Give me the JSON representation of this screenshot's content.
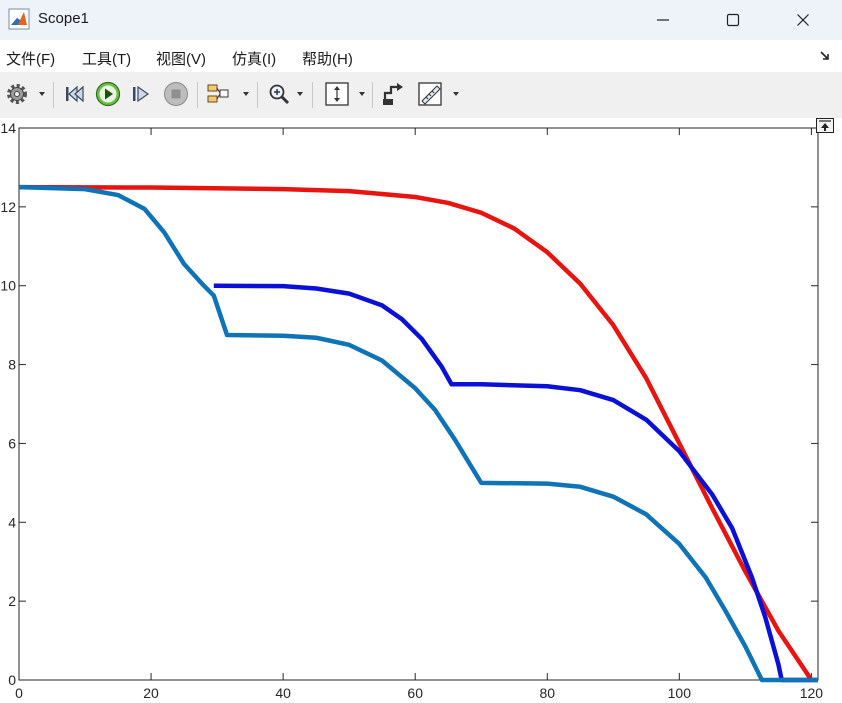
{
  "window": {
    "title": "Scope1"
  },
  "menu": {
    "items": [
      {
        "label": "文件(F)"
      },
      {
        "label": "工具(T)"
      },
      {
        "label": "视图(V)"
      },
      {
        "label": "仿真(I)"
      },
      {
        "label": "帮助(H)"
      }
    ]
  },
  "toolbar": {
    "icons": [
      "gear-icon",
      "rewind-icon",
      "run-icon",
      "step-forward-icon",
      "stop-icon",
      "signal-selector-icon",
      "zoom-in-icon",
      "fit-axes-icon",
      "highlight-block-icon",
      "measurements-icon"
    ]
  },
  "chart_data": {
    "type": "line",
    "xlim": [
      0,
      121
    ],
    "ylim": [
      0,
      14
    ],
    "xticks": [
      0,
      20,
      40,
      60,
      80,
      100,
      120
    ],
    "yticks": [
      0,
      2,
      4,
      6,
      8,
      10,
      12,
      14
    ],
    "grid": false,
    "series": [
      {
        "color": "#e8140f",
        "points": [
          [
            0,
            12.5
          ],
          [
            20,
            12.49
          ],
          [
            40,
            12.45
          ],
          [
            50,
            12.4
          ],
          [
            60,
            12.25
          ],
          [
            65,
            12.1
          ],
          [
            70,
            11.85
          ],
          [
            75,
            11.45
          ],
          [
            80,
            10.85
          ],
          [
            85,
            10.05
          ],
          [
            90,
            9.0
          ],
          [
            95,
            7.65
          ],
          [
            100,
            6.0
          ],
          [
            105,
            4.35
          ],
          [
            110,
            2.75
          ],
          [
            115,
            1.25
          ],
          [
            118,
            0.5
          ],
          [
            120,
            0.0
          ]
        ]
      },
      {
        "color": "#0a10d6",
        "points": [
          [
            29.5,
            10.0
          ],
          [
            40,
            9.99
          ],
          [
            45,
            9.93
          ],
          [
            50,
            9.8
          ],
          [
            55,
            9.5
          ],
          [
            58,
            9.15
          ],
          [
            61,
            8.65
          ],
          [
            64,
            7.95
          ],
          [
            65.5,
            7.5
          ],
          [
            70,
            7.5
          ],
          [
            80,
            7.45
          ],
          [
            85,
            7.35
          ],
          [
            90,
            7.1
          ],
          [
            95,
            6.6
          ],
          [
            100,
            5.8
          ],
          [
            105,
            4.7
          ],
          [
            108,
            3.85
          ],
          [
            111,
            2.6
          ],
          [
            113,
            1.6
          ],
          [
            115,
            0.4
          ],
          [
            115.5,
            0.0
          ],
          [
            121,
            0.0
          ]
        ]
      },
      {
        "color": "#0f73b8",
        "points": [
          [
            0,
            12.5
          ],
          [
            10,
            12.45
          ],
          [
            15,
            12.3
          ],
          [
            19,
            11.95
          ],
          [
            22,
            11.35
          ],
          [
            25,
            10.55
          ],
          [
            28,
            10.0
          ],
          [
            29.5,
            9.75
          ],
          [
            31.5,
            8.75
          ],
          [
            40,
            8.73
          ],
          [
            45,
            8.68
          ],
          [
            50,
            8.5
          ],
          [
            55,
            8.1
          ],
          [
            60,
            7.4
          ],
          [
            63,
            6.85
          ],
          [
            66,
            6.1
          ],
          [
            68,
            5.55
          ],
          [
            70,
            5.0
          ],
          [
            80,
            4.98
          ],
          [
            85,
            4.9
          ],
          [
            90,
            4.65
          ],
          [
            95,
            4.2
          ],
          [
            100,
            3.45
          ],
          [
            104,
            2.6
          ],
          [
            107,
            1.75
          ],
          [
            110,
            0.85
          ],
          [
            112.5,
            0.0
          ],
          [
            121,
            0.0
          ]
        ]
      }
    ]
  }
}
